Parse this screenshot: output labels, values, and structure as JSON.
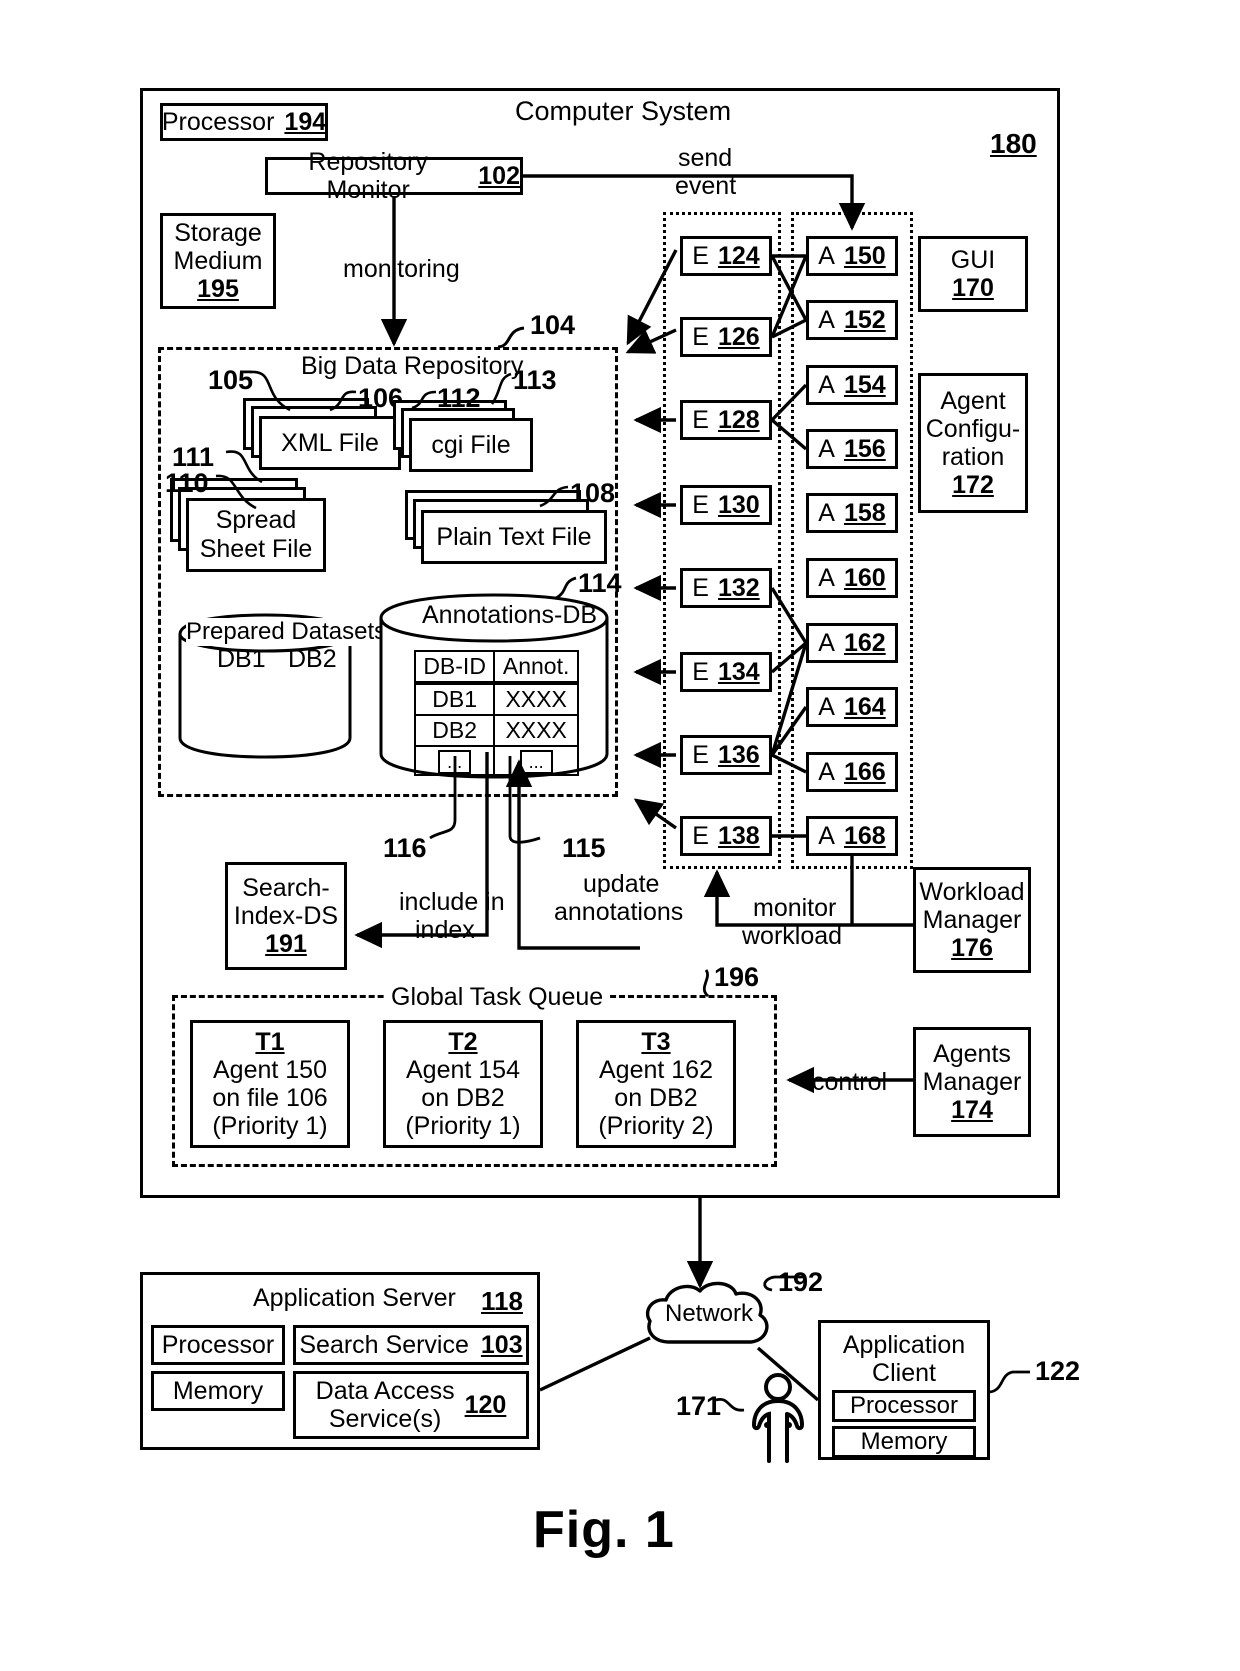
{
  "figure": {
    "caption": "Fig. 1"
  },
  "system": {
    "title": "Computer System",
    "ref": "180",
    "processor": {
      "label": "Processor",
      "ref": "194"
    },
    "storage_medium": {
      "line1": "Storage",
      "line2": "Medium",
      "ref": "195"
    },
    "repository_monitor": {
      "label": "Repository Monitor",
      "ref": "102"
    },
    "monitoring_label": "monitoring",
    "send_event_label_line1": "send",
    "send_event_label_line2": "event"
  },
  "repository": {
    "title": "Big Data Repository",
    "ref": "104",
    "files": [
      {
        "label": "XML File",
        "refs": [
          "105",
          "106"
        ]
      },
      {
        "label": "cgi File",
        "refs": [
          "112",
          "113"
        ]
      },
      {
        "label": "Spread Sheet File",
        "line1": "Spread",
        "line2": "Sheet File",
        "refs": [
          "111",
          "110"
        ]
      },
      {
        "label": "Plain Text File",
        "refs": [
          "108"
        ]
      }
    ],
    "prepared_datasets": {
      "title": "Prepared Datasets",
      "db1": "DB1",
      "db2": "DB2"
    },
    "annotations_db": {
      "title": "Annotations-DB",
      "ref": "114",
      "columns": [
        "DB-ID",
        "Annot."
      ],
      "rows": [
        [
          "DB1",
          "XXXX"
        ],
        [
          "DB2",
          "XXXX"
        ],
        [
          "...",
          "..."
        ]
      ],
      "ref_116": "116",
      "ref_115": "115"
    }
  },
  "events": [
    {
      "prefix": "E",
      "ref": "124"
    },
    {
      "prefix": "E",
      "ref": "126"
    },
    {
      "prefix": "E",
      "ref": "128"
    },
    {
      "prefix": "E",
      "ref": "130"
    },
    {
      "prefix": "E",
      "ref": "132"
    },
    {
      "prefix": "E",
      "ref": "134"
    },
    {
      "prefix": "E",
      "ref": "136"
    },
    {
      "prefix": "E",
      "ref": "138"
    }
  ],
  "agents": [
    {
      "prefix": "A",
      "ref": "150"
    },
    {
      "prefix": "A",
      "ref": "152"
    },
    {
      "prefix": "A",
      "ref": "154"
    },
    {
      "prefix": "A",
      "ref": "156"
    },
    {
      "prefix": "A",
      "ref": "158"
    },
    {
      "prefix": "A",
      "ref": "160"
    },
    {
      "prefix": "A",
      "ref": "162"
    },
    {
      "prefix": "A",
      "ref": "164"
    },
    {
      "prefix": "A",
      "ref": "166"
    },
    {
      "prefix": "A",
      "ref": "168"
    }
  ],
  "right_panels": {
    "gui": {
      "label": "GUI",
      "ref": "170"
    },
    "agent_configuration": {
      "line1": "Agent",
      "line2": "Configu-",
      "line3": "ration",
      "ref": "172"
    },
    "workload_manager": {
      "line1": "Workload",
      "line2": "Manager",
      "ref": "176"
    },
    "agents_manager": {
      "line1": "Agents",
      "line2": "Manager",
      "ref": "174"
    }
  },
  "search_index": {
    "line1": "Search-",
    "line2": "Index-DS",
    "ref": "191"
  },
  "edge_labels": {
    "include_in_index_line1": "include in",
    "include_in_index_line2": "index",
    "update_annotations_line1": "update",
    "update_annotations_line2": "annotations",
    "monitor_workload_line1": "monitor",
    "monitor_workload_line2": "workload",
    "control": "control"
  },
  "task_queue": {
    "title": "Global Task Queue",
    "ref": "196",
    "tasks": [
      {
        "id": "T1",
        "line1": "Agent 150",
        "line2": "on file 106",
        "line3": "(Priority 1)"
      },
      {
        "id": "T2",
        "line1": "Agent 154",
        "line2": "on DB2",
        "line3": "(Priority 1)"
      },
      {
        "id": "T3",
        "line1": "Agent 162",
        "line2": "on DB2",
        "line3": "(Priority 2)"
      }
    ]
  },
  "application_server": {
    "title": "Application Server",
    "ref": "118",
    "processor": "Processor",
    "memory": "Memory",
    "search_service": {
      "label": "Search Service",
      "ref": "103"
    },
    "data_access": {
      "line1": "Data Access",
      "line2": "Service(s)",
      "ref": "120"
    }
  },
  "network": {
    "label": "Network",
    "ref": "192"
  },
  "user": {
    "ref": "171"
  },
  "application_client": {
    "line1": "Application",
    "line2": "Client",
    "ref": "122",
    "processor": "Processor",
    "memory": "Memory"
  }
}
